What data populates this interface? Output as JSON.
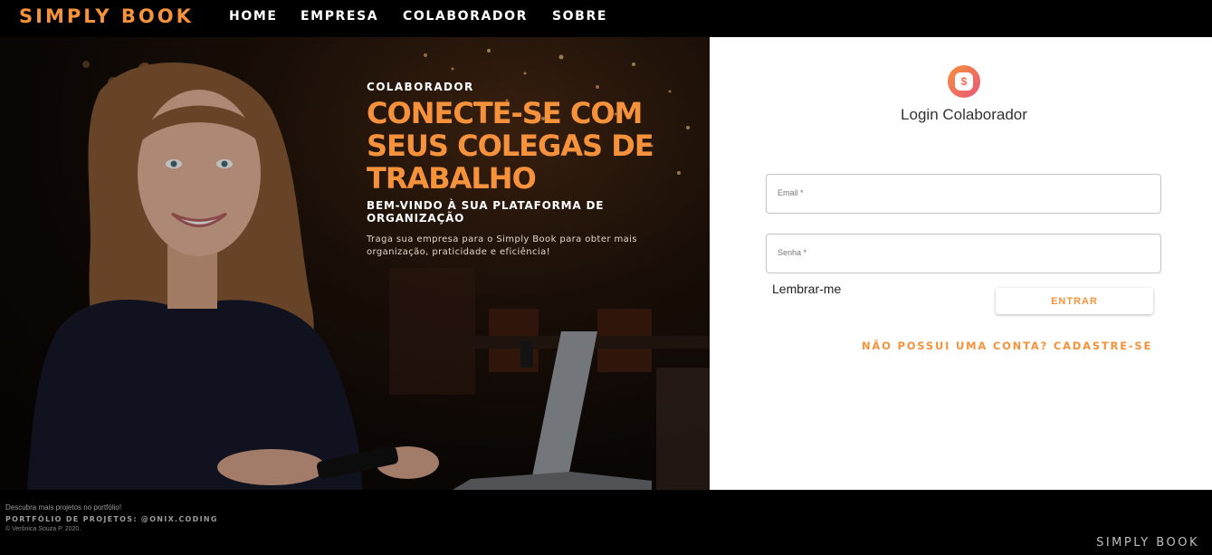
{
  "nav": {
    "brand": "SIMPLY BOOK",
    "items": [
      {
        "label": "HOME"
      },
      {
        "label": "EMPRESA"
      },
      {
        "label": "COLABORADOR"
      },
      {
        "label": "SOBRE"
      }
    ]
  },
  "hero": {
    "eyebrow": "COLABORADOR",
    "headline": "CONECTE-SE COM SEUS COLEGAS DE TRABALHO",
    "subhead": "BEM-VINDO À SUA PLATAFORMA DE ORGANIZAÇÃO",
    "description": "Traga sua empresa para o Simply Book para obter mais organização, praticidade e eficiência!"
  },
  "login": {
    "icon": "app-logo-icon",
    "title": "Login Colaborador",
    "email_label": "Email *",
    "password_label": "Senha *",
    "remember_label": "Lembrar-me",
    "submit_label": "ENTRAR",
    "signup_link": "NÃO POSSUI UMA CONTA? CADASTRE-SE"
  },
  "footer": {
    "line1": "Descubra mais projetos no portfólio!",
    "line2": "PORTFÓLIO DE PROJETOS: @ONIX.CODING",
    "line3": "© Verônica Souza P. 2020.",
    "brand": "SIMPLY BOOK"
  },
  "colors": {
    "accent": "#f6923b",
    "nav_bg": "#000000",
    "panel_bg": "#ffffff"
  }
}
